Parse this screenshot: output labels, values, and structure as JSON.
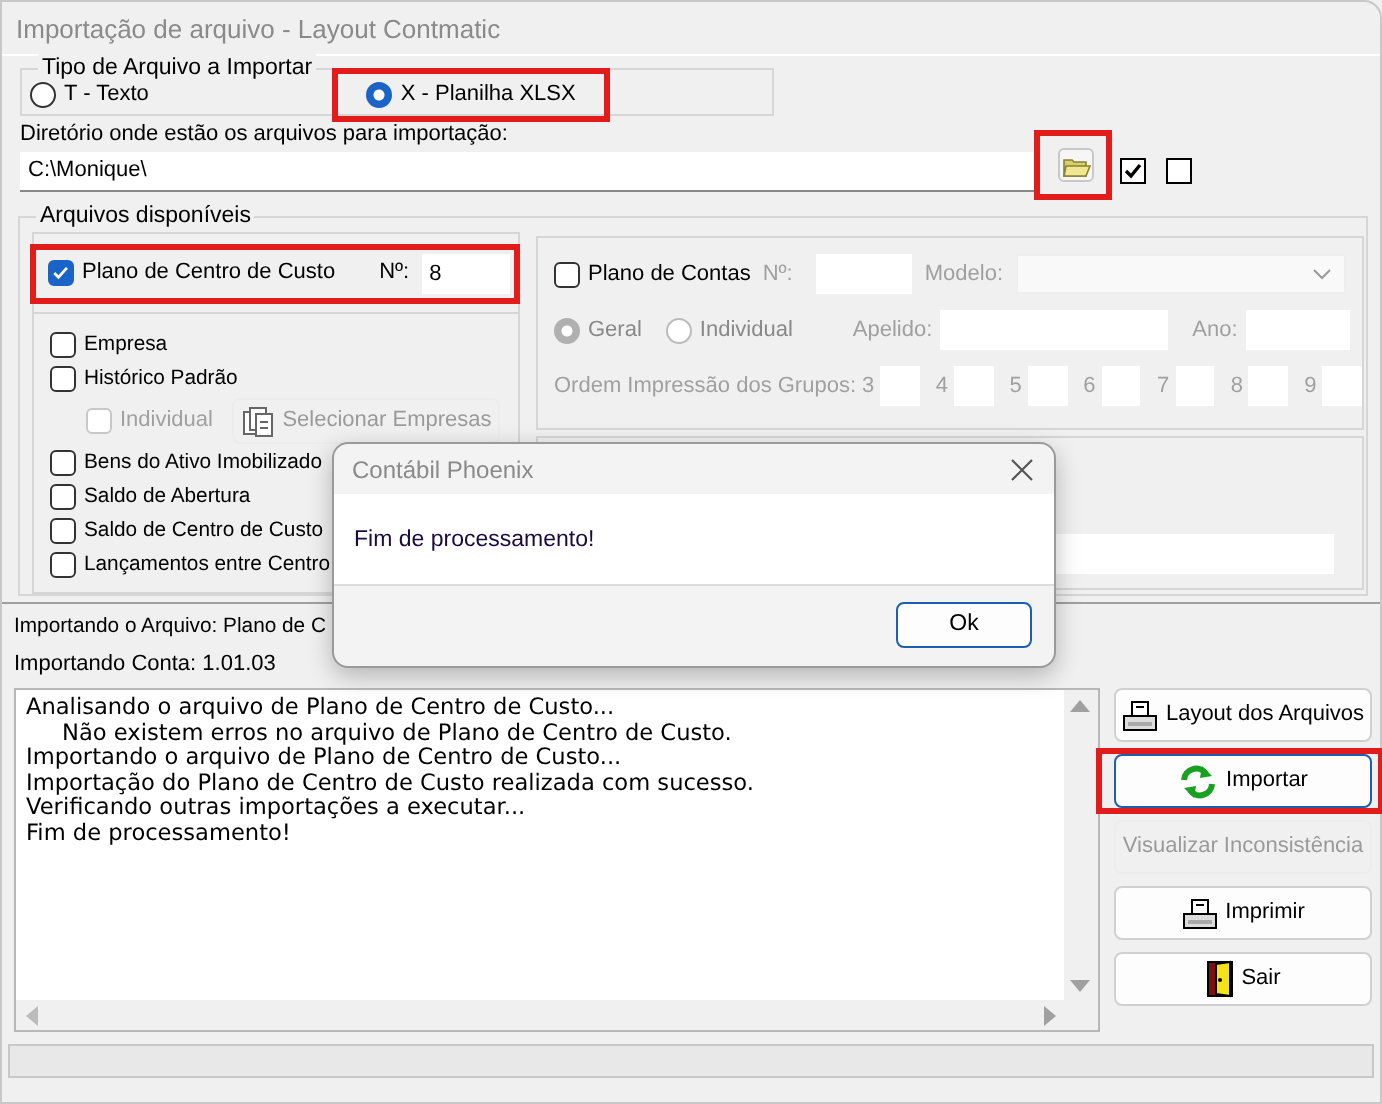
{
  "window": {
    "title": "Importação de arquivo - Layout Contmatic"
  },
  "file_type": {
    "label": "Tipo de Arquivo a Importar",
    "options": [
      {
        "label": "T - Texto",
        "selected": false,
        "highlighted": false
      },
      {
        "label": "X - Planilha XLSX",
        "selected": true,
        "highlighted": true
      }
    ]
  },
  "directory": {
    "label": "Diretório onde estão os arquivos para importação:",
    "value": "C:\\Monique\\",
    "browse_highlighted": true,
    "options": [
      {
        "checked": true
      },
      {
        "checked": false
      }
    ]
  },
  "available": {
    "label": "Arquivos disponíveis",
    "cost_center_plan": {
      "label": "Plano de Centro de Custo",
      "checked": true,
      "highlighted": true,
      "number_label": "Nº:",
      "number": "8"
    },
    "items": [
      {
        "kind": "check",
        "label": "Empresa",
        "checked": false
      },
      {
        "kind": "check",
        "label": "Histórico Padrão",
        "checked": false
      },
      {
        "kind": "sub",
        "label": "Individual",
        "checked": false,
        "disabled": true,
        "button": "Selecionar Empresas"
      },
      {
        "kind": "check",
        "label": "Bens do Ativo Imobilizado",
        "checked": false
      },
      {
        "kind": "check",
        "label": "Saldo de Abertura",
        "checked": false
      },
      {
        "kind": "check",
        "label": "Saldo de Centro de Custo",
        "checked": false
      },
      {
        "kind": "check",
        "label": "Lançamentos entre Centro",
        "checked": false
      }
    ],
    "chart_of_accounts": {
      "label": "Plano de Contas",
      "checked": false,
      "number_label": "Nº:",
      "model_label": "Modelo:",
      "scopes": [
        {
          "label": "Geral",
          "selected": true
        },
        {
          "label": "Individual",
          "selected": false
        }
      ],
      "nickname_label": "Apelido:",
      "year_label": "Ano:",
      "order_label": "Ordem Impressão dos Grupos:",
      "groups": [
        "3",
        "4",
        "5",
        "6",
        "7",
        "8",
        "9"
      ]
    }
  },
  "progress": {
    "file": "Importando o Arquivo: Plano de C",
    "account": "Importando Conta: 1.01.03"
  },
  "log": [
    {
      "text": "Analisando o arquivo de Plano de Centro de Custo...",
      "indented": false
    },
    {
      "text": "Não existem erros no arquivo de Plano de Centro de Custo.",
      "indented": true
    },
    {
      "text": "Importando o arquivo de Plano de Centro de Custo...",
      "indented": false
    },
    {
      "text": "Importação do Plano de Centro de Custo realizada com sucesso.",
      "indented": false
    },
    {
      "text": "Verificando outras importações a executar...",
      "indented": false
    },
    {
      "text": "Fim de processamento!",
      "indented": false
    }
  ],
  "actions": [
    {
      "kind": "printer",
      "label": "Layout dos Arquivos",
      "disabled": false,
      "focused": false,
      "highlighted": false
    },
    {
      "kind": "refresh",
      "label": "Importar",
      "disabled": false,
      "focused": true,
      "highlighted": true
    },
    {
      "kind": "none",
      "label": "Visualizar Inconsistência",
      "disabled": true,
      "focused": false,
      "highlighted": false
    },
    {
      "kind": "printer",
      "label": "Imprimir",
      "disabled": false,
      "focused": false,
      "highlighted": false
    },
    {
      "kind": "door",
      "label": "Sair",
      "disabled": false,
      "focused": false,
      "highlighted": false
    }
  ],
  "dialog": {
    "title": "Contábil Phoenix",
    "message": "Fim de processamento!",
    "button": "Ok"
  }
}
